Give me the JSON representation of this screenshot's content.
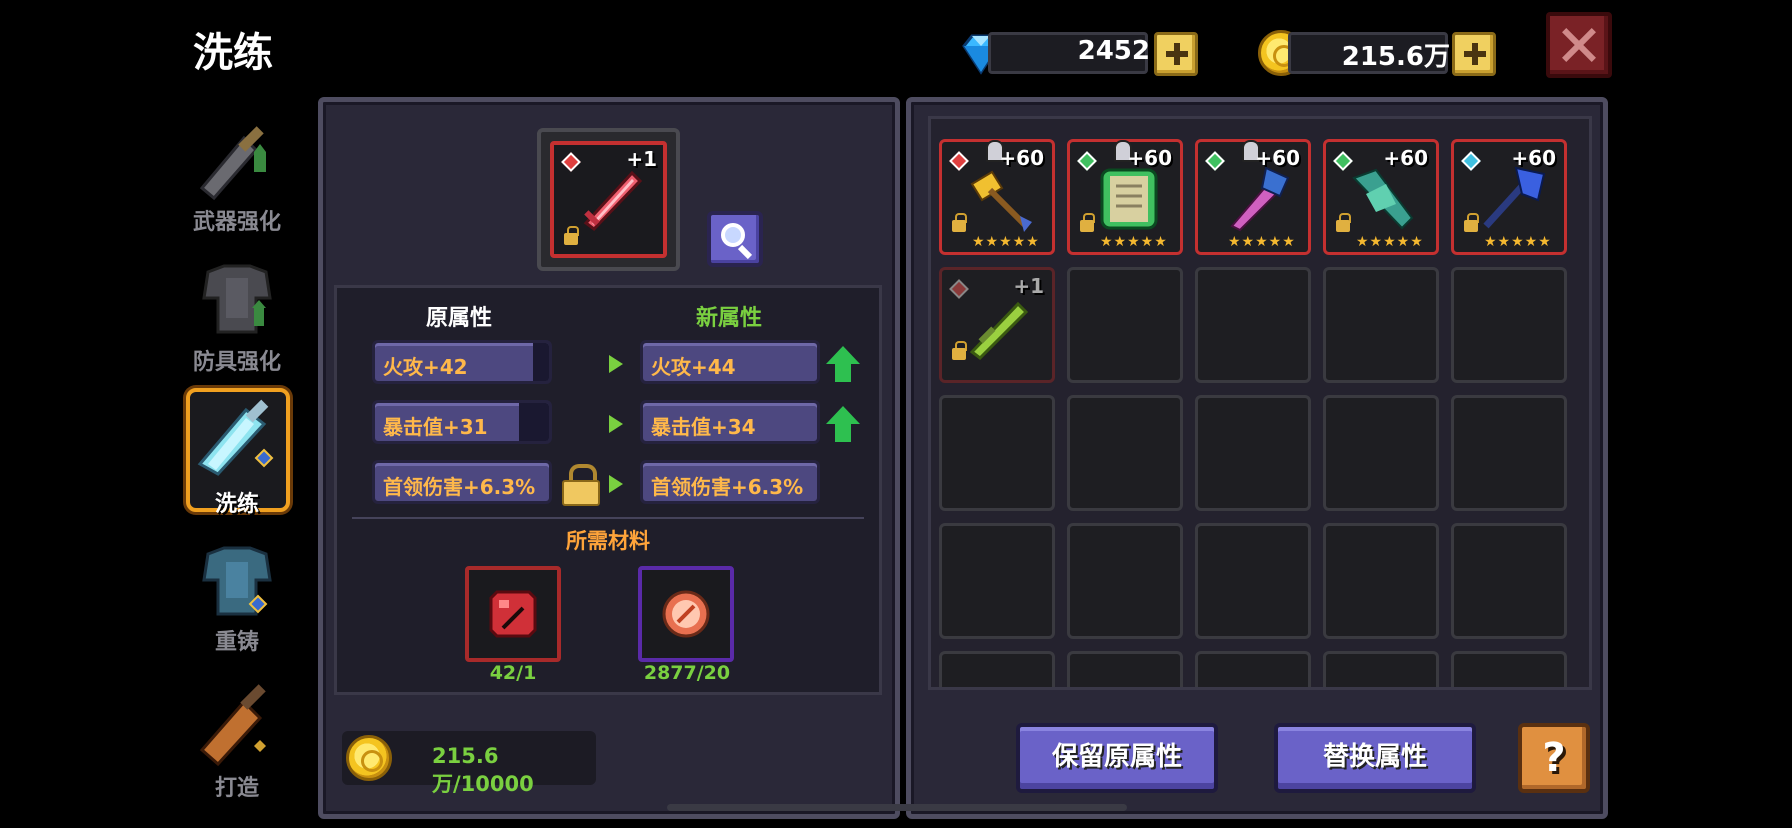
{
  "header": {
    "title": "洗练"
  },
  "currency": {
    "gems": "2452",
    "gold": "215.6万",
    "gem_icon": "diamond-icon",
    "gold_icon": "gold-coin-icon"
  },
  "nav": {
    "items": [
      {
        "label": "武器强化",
        "icon": "weapon-upgrade-icon"
      },
      {
        "label": "防具强化",
        "icon": "armor-upgrade-icon"
      },
      {
        "label": "洗练",
        "icon": "reforge-sword-icon"
      },
      {
        "label": "重铸",
        "icon": "recast-armor-icon"
      },
      {
        "label": "打造",
        "icon": "forge-icon"
      }
    ],
    "active": "洗练"
  },
  "selected_item": {
    "level": "+1"
  },
  "stats": {
    "old_header": "原属性",
    "new_header": "新属性",
    "rows": [
      {
        "old": "火攻+42",
        "new": "火攻+44",
        "old_fill": 0.9,
        "up": true,
        "locked": false
      },
      {
        "old": "暴击值+31",
        "new": "暴击值+34",
        "old_fill": 0.8,
        "up": true,
        "locked": false
      },
      {
        "old": "首领伤害+6.3%",
        "new": "首领伤害+6.3%",
        "old_fill": 1.0,
        "up": false,
        "locked": true
      }
    ]
  },
  "materials": {
    "header": "所需材料",
    "items": [
      {
        "count": "42/1",
        "icon": "red-stone-icon"
      },
      {
        "count": "2877/20",
        "icon": "copper-orb-icon"
      }
    ]
  },
  "cost": {
    "gold": "215.6万/10000"
  },
  "inventory": {
    "items": [
      {
        "level": "+60",
        "element": "fire",
        "stars": "★★★★★"
      },
      {
        "level": "+60",
        "element": "nature",
        "stars": "★★★★★"
      },
      {
        "level": "+60",
        "element": "nature",
        "stars": "★★★★★"
      },
      {
        "level": "+60",
        "element": "nature",
        "stars": "★★★★★"
      },
      {
        "level": "+60",
        "element": "ice",
        "stars": "★★★★★"
      },
      {
        "level": "+1",
        "element": "fire",
        "stars": ""
      }
    ]
  },
  "buttons": {
    "keep": "保留原属性",
    "replace": "替换属性",
    "help": "?"
  },
  "colors": {
    "accent_orange": "#ffa43a",
    "new_green": "#7ad040",
    "panel": "#2a2838",
    "button_purple": "#6a62c8"
  }
}
